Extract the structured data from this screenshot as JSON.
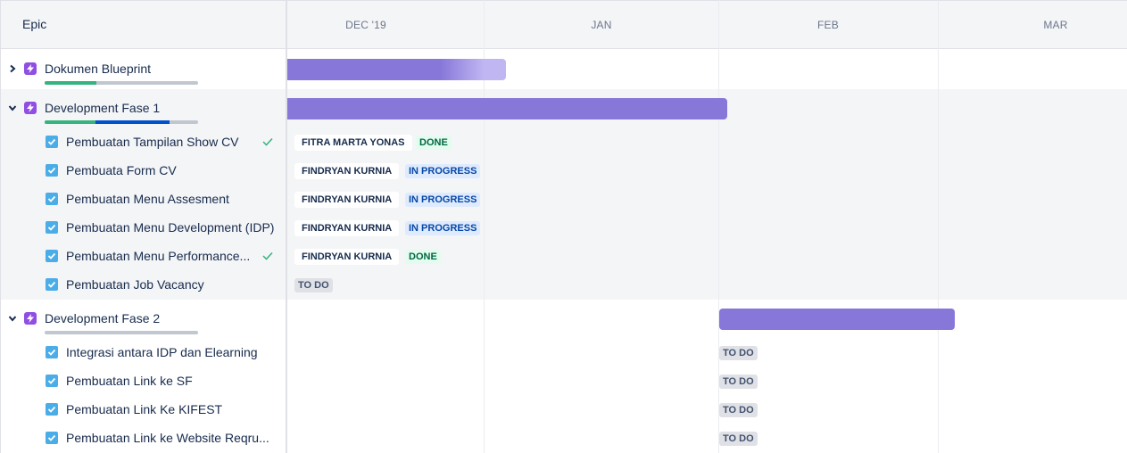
{
  "header": {
    "column_title": "Epic",
    "months": [
      "DEC '19",
      "JAN",
      "FEB",
      "MAR"
    ]
  },
  "colors": {
    "bar": "#8777d9",
    "bar_faded": "#c0b6f2",
    "epic_icon": "#904ee2",
    "checkbox": "#4bade8",
    "progress_done": "#36b37e",
    "progress_inprogress": "#0052cc",
    "progress_todo": "#c1c7d0"
  },
  "epics": [
    {
      "name": "Dokumen Blueprint",
      "expanded": false,
      "progress": {
        "done": 0.34,
        "in_progress": 0.0
      },
      "issues": []
    },
    {
      "name": "Development Fase 1",
      "expanded": true,
      "progress": {
        "done": 0.33,
        "in_progress": 0.48
      },
      "issues": [
        {
          "title": "Pembuatan Tampilan Show CV",
          "done": true,
          "assignee": "FITRA MARTA YONAS",
          "status": "DONE"
        },
        {
          "title": "Pembuata Form CV",
          "done": false,
          "assignee": "FINDRYAN KURNIA",
          "status": "IN PROGRESS"
        },
        {
          "title": "Pembuatan Menu Assesment",
          "done": false,
          "assignee": "FINDRYAN KURNIA",
          "status": "IN PROGRESS"
        },
        {
          "title": "Pembuatan Menu Development (IDP)",
          "done": false,
          "assignee": "FINDRYAN KURNIA",
          "status": "IN PROGRESS"
        },
        {
          "title": "Pembuatan Menu Performance...",
          "done": true,
          "assignee": "FINDRYAN KURNIA",
          "status": "DONE"
        },
        {
          "title": "Pembuatan Job Vacancy",
          "done": false,
          "assignee": "",
          "status": "TO DO"
        }
      ]
    },
    {
      "name": "Development Fase 2",
      "expanded": true,
      "progress": {
        "done": 0.0,
        "in_progress": 0.0
      },
      "issues": [
        {
          "title": "Integrasi antara IDP dan Elearning",
          "done": false,
          "assignee": "",
          "status": "TO DO"
        },
        {
          "title": "Pembuatan Link ke SF",
          "done": false,
          "assignee": "",
          "status": "TO DO"
        },
        {
          "title": "Pembuatan Link Ke KIFEST",
          "done": false,
          "assignee": "",
          "status": "TO DO"
        },
        {
          "title": "Pembuatan Link ke Website Reqru...",
          "done": false,
          "assignee": "",
          "status": "TO DO"
        }
      ]
    }
  ]
}
